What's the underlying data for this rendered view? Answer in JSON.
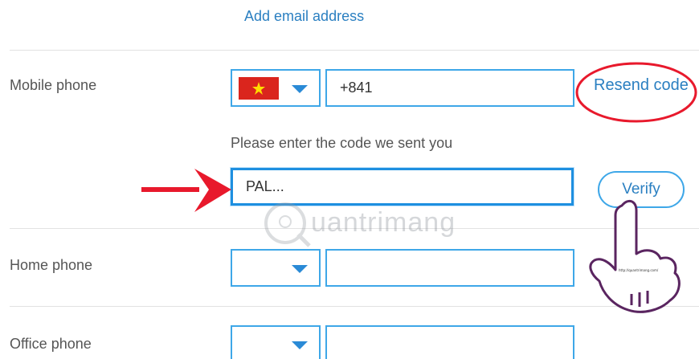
{
  "email": {
    "add_label": "Add email address"
  },
  "mobile": {
    "label": "Mobile phone",
    "country_flag": "vietnam-flag",
    "number": "+841",
    "resend_label": "Resend code",
    "prompt": "Please enter the code we sent you",
    "code_value": "PAL..."
  },
  "verify": {
    "label": "Verify"
  },
  "home": {
    "label": "Home phone",
    "number": ""
  },
  "office": {
    "label": "Office phone",
    "number": ""
  },
  "watermark": {
    "text": "uantrimang"
  },
  "colors": {
    "accent": "#2a7fc1",
    "border": "#3ea7e8",
    "annotation_red": "#e8192c",
    "hand_outline": "#5a2560"
  }
}
